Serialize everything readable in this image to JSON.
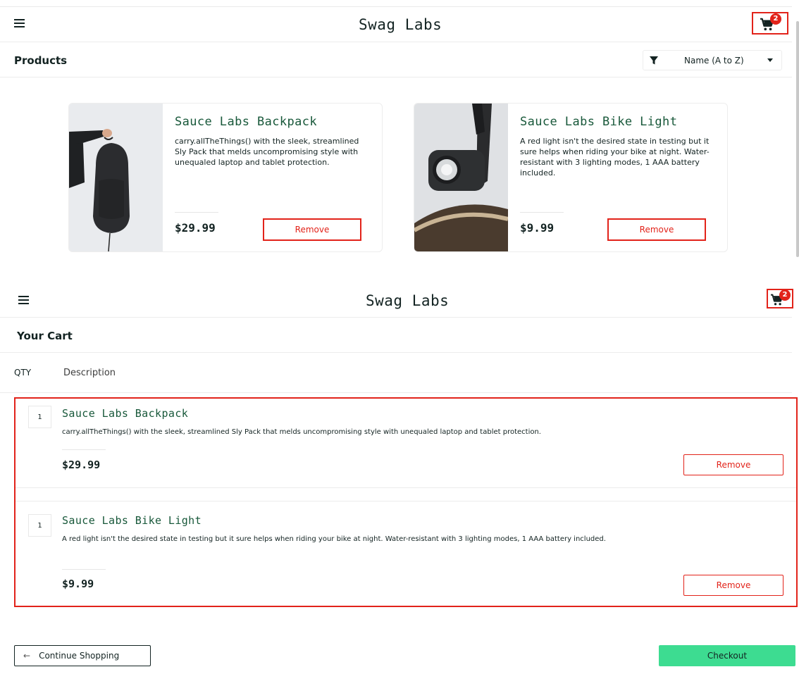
{
  "app": {
    "title": "Swag Labs",
    "cart_count": "2"
  },
  "colors": {
    "accent_red": "#e2231a",
    "product_green": "#18583a",
    "checkout_green": "#3ddc91"
  },
  "inventory": {
    "section_title": "Products",
    "sort": {
      "selected": "Name (A to Z)",
      "icon": "filter-icon"
    },
    "products": [
      {
        "name": "Sauce Labs Backpack",
        "description": "carry.allTheThings() with the sleek, streamlined Sly Pack that melds uncompromising style with unequaled laptop and tablet protection.",
        "price": "$29.99",
        "button_label": "Remove"
      },
      {
        "name": "Sauce Labs Bike Light",
        "description": "A red light isn't the desired state in testing but it sure helps when riding your bike at night. Water-resistant with 3 lighting modes, 1 AAA battery included.",
        "price": "$9.99",
        "button_label": "Remove"
      }
    ]
  },
  "cart": {
    "section_title": "Your Cart",
    "qty_header": "QTY",
    "description_header": "Description",
    "items": [
      {
        "qty": "1",
        "name": "Sauce Labs Backpack",
        "description": "carry.allTheThings() with the sleek, streamlined Sly Pack that melds uncompromising style with unequaled laptop and tablet protection.",
        "price": "$29.99",
        "button_label": "Remove"
      },
      {
        "qty": "1",
        "name": "Sauce Labs Bike Light",
        "description": "A red light isn't the desired state in testing but it sure helps when riding your bike at night. Water-resistant with 3 lighting modes, 1 AAA battery included.",
        "price": "$9.99",
        "button_label": "Remove"
      }
    ],
    "continue_label": "Continue Shopping",
    "checkout_label": "Checkout"
  }
}
